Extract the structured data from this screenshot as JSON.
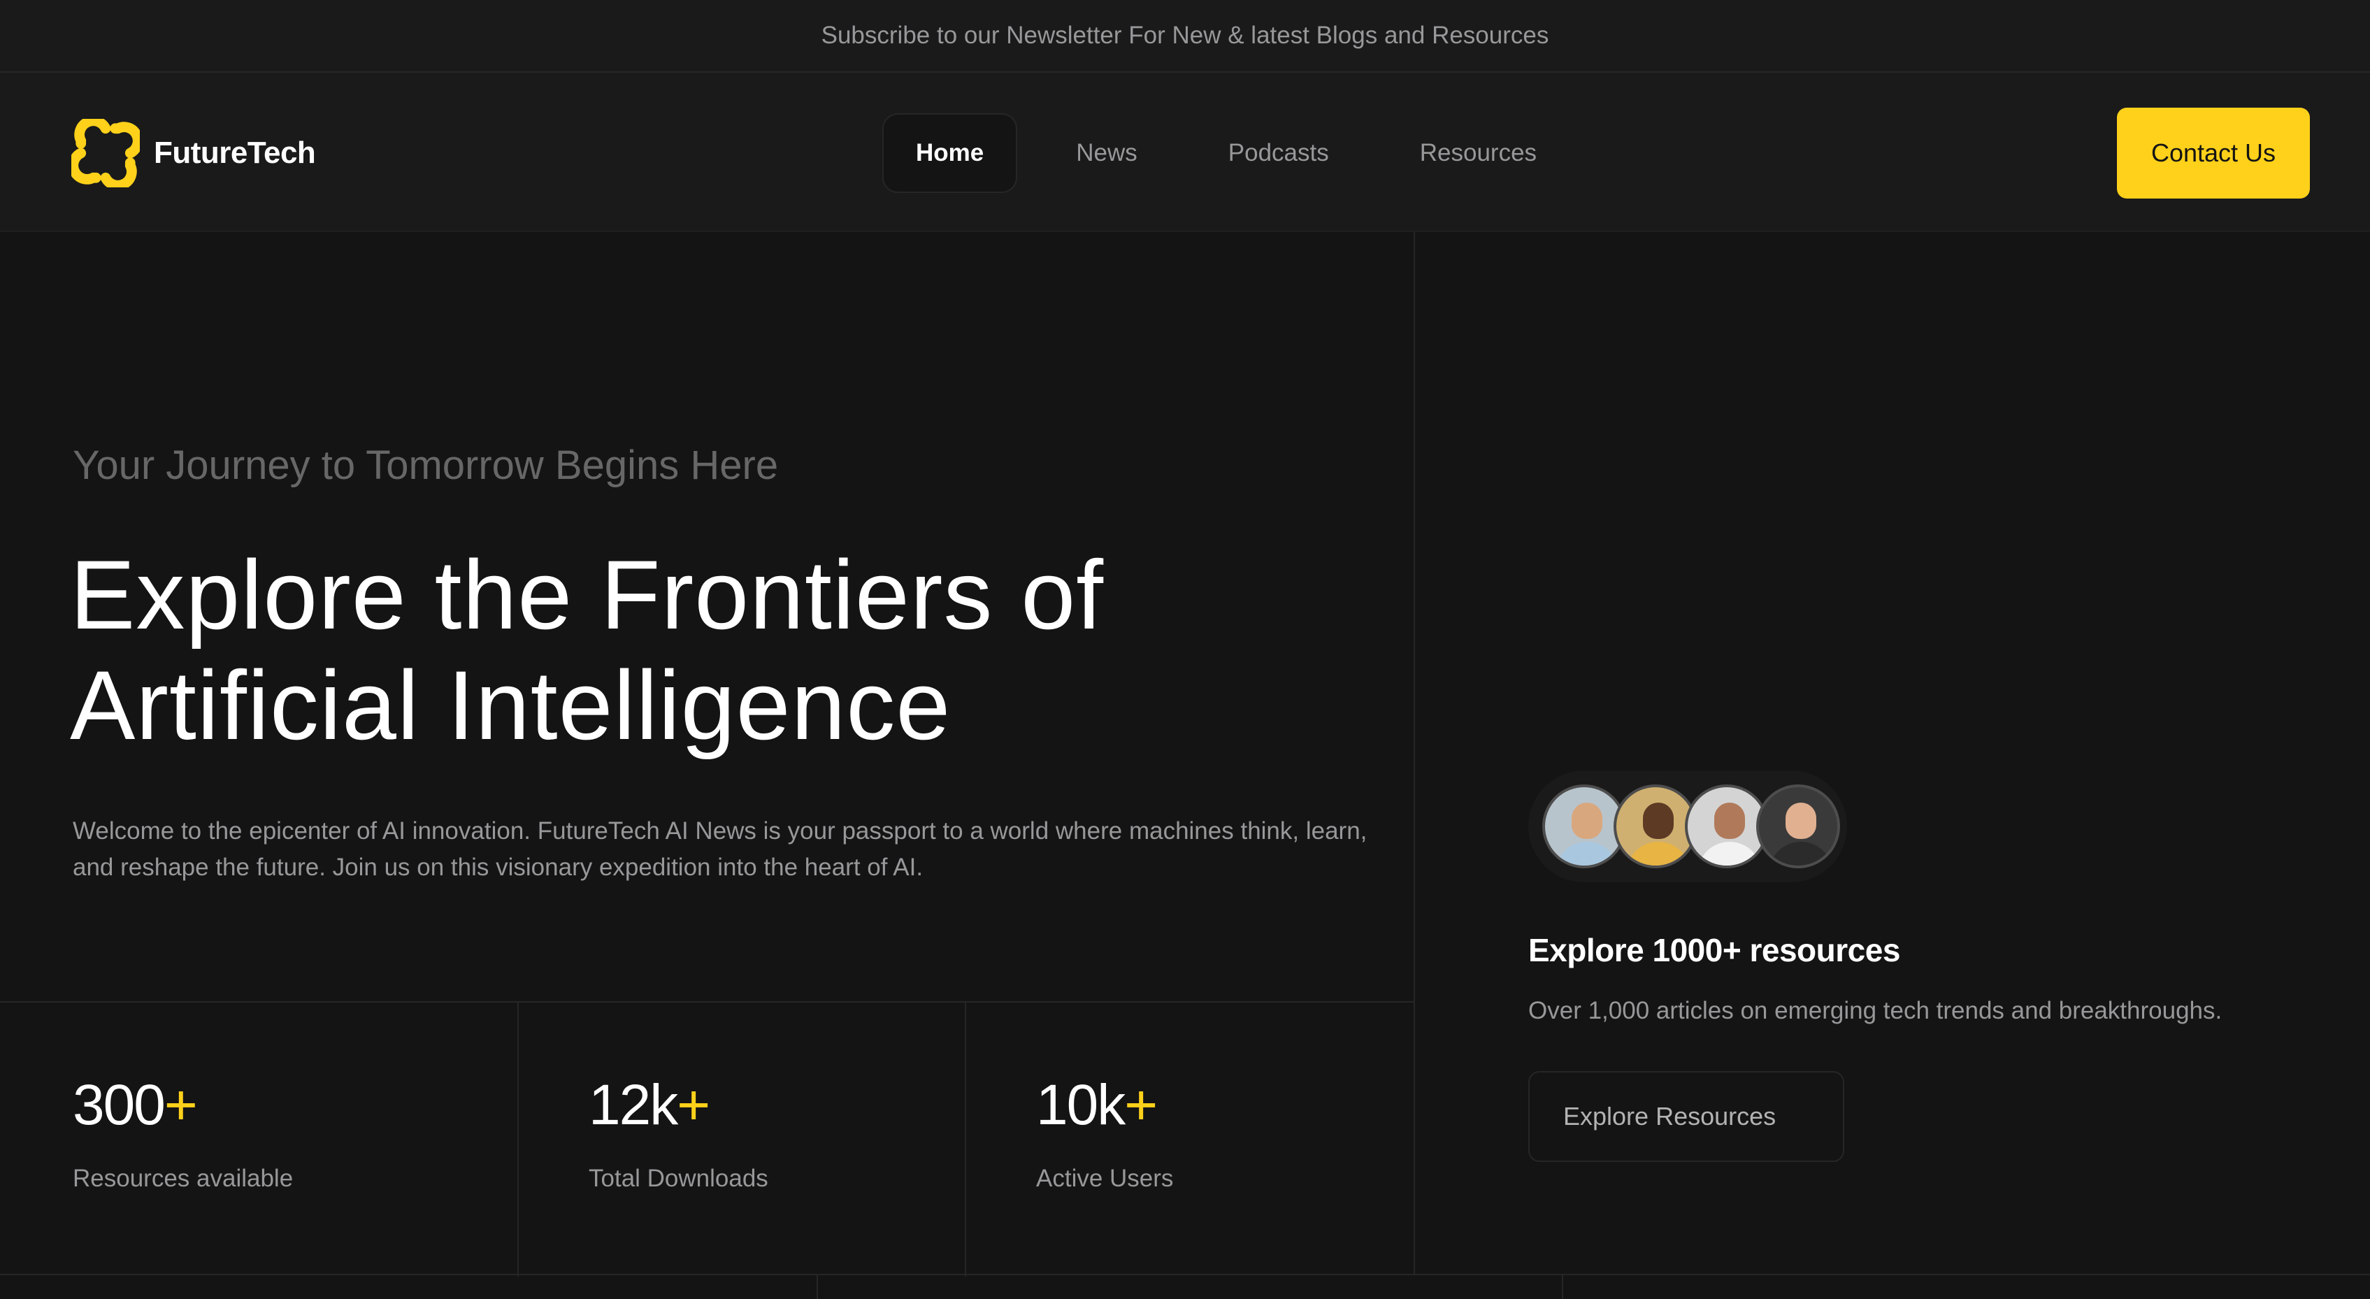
{
  "topbar": {
    "text": "Subscribe to our Newsletter For New & latest Blogs and Resources"
  },
  "brand": {
    "name": "FutureTech",
    "logo_icon": "futuretech-logo-icon",
    "accent_color": "#ffd11a"
  },
  "nav": {
    "items": [
      {
        "label": "Home",
        "active": true
      },
      {
        "label": "News",
        "active": false
      },
      {
        "label": "Podcasts",
        "active": false
      },
      {
        "label": "Resources",
        "active": false
      }
    ],
    "contact_label": "Contact Us"
  },
  "hero": {
    "tagline": "Your Journey to Tomorrow Begins Here",
    "headline_line1": "Explore the Frontiers of",
    "headline_line2": "Artificial Intelligence",
    "description": "Welcome to the epicenter of AI innovation. FutureTech AI News is your passport to a world where machines think, learn, and reshape the future. Join us on this visionary expedition into the heart of AI."
  },
  "stats": [
    {
      "value": "300",
      "suffix": "+",
      "label": "Resources available"
    },
    {
      "value": "12k",
      "suffix": "+",
      "label": "Total Downloads"
    },
    {
      "value": "10k",
      "suffix": "+",
      "label": "Active Users"
    }
  ],
  "resources": {
    "title": "Explore 1000+ resources",
    "description": "Over 1,000 articles on emerging tech trends and breakthroughs.",
    "button_label": "Explore Resources",
    "avatars": [
      "user-avatar-1",
      "user-avatar-2",
      "user-avatar-3",
      "user-avatar-4"
    ]
  }
}
